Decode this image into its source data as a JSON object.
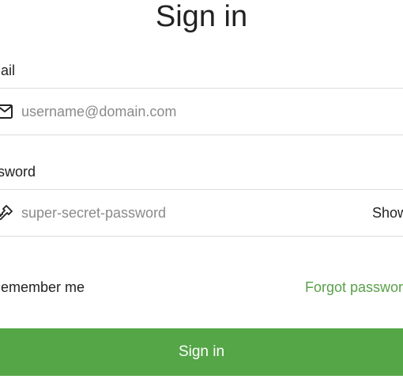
{
  "form": {
    "title": "Sign in",
    "email": {
      "label": "Email",
      "placeholder": "username@domain.com",
      "value": "",
      "icon": "envelope-icon"
    },
    "password": {
      "label": "Password",
      "placeholder": "super-secret-password",
      "value": "",
      "icon": "key-icon",
      "toggle_label": "Show"
    },
    "remember_label": "Remember me",
    "remember_checked": false,
    "forgot_label": "Forgot password?",
    "submit_label": "Sign in"
  },
  "colors": {
    "accent": "#54a647",
    "link": "#5aa04a",
    "divider": "#dcdcdc"
  }
}
